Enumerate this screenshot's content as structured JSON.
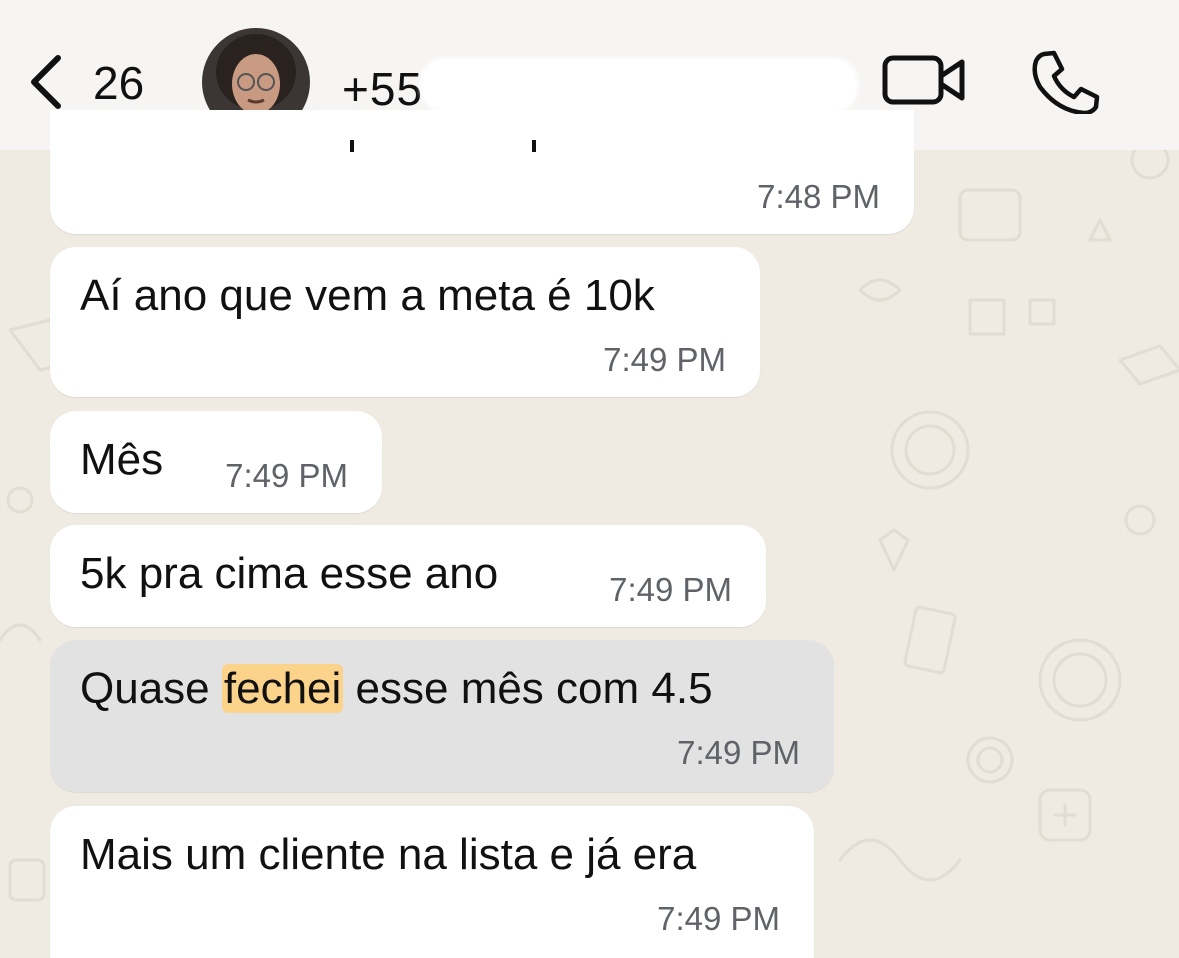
{
  "header": {
    "unread_count": "26",
    "contact_name": "+55",
    "back_icon": "chevron-left-icon",
    "video_icon": "video-camera-icon",
    "call_icon": "phone-icon"
  },
  "messages": [
    {
      "text": "",
      "time": "7:48 PM"
    },
    {
      "text": "Aí ano que vem a meta é 10k",
      "time": "7:49 PM"
    },
    {
      "text": "Mês",
      "time": "7:49 PM"
    },
    {
      "text": "5k pra cima esse ano",
      "time": "7:49 PM"
    },
    {
      "text_before": "Quase ",
      "highlight": "fechei",
      "text_after": " esse mês com 4.5",
      "time": "7:49 PM",
      "highlighted": true
    },
    {
      "text": "Mais um cliente na lista e já era",
      "time": "7:49 PM"
    }
  ],
  "colors": {
    "background": "#efeae2",
    "bubble": "#ffffff",
    "highlighted_bubble": "#e3e2e3",
    "search_highlight": "#fcd38a"
  }
}
